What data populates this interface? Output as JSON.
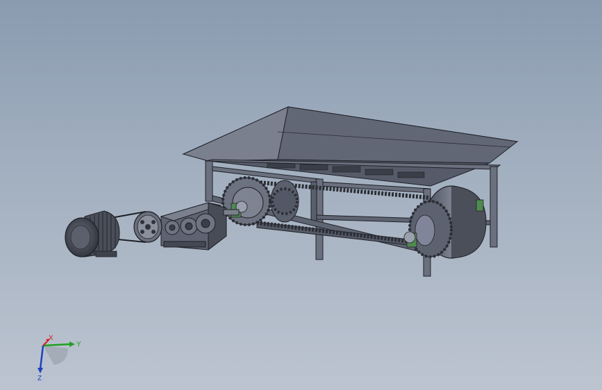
{
  "viewport": {
    "background_top": "#8a9bb0",
    "background_bottom": "#bcc4d0"
  },
  "colors": {
    "steel_light": "#7a7f8c",
    "steel_mid": "#5c6170",
    "steel_dark": "#3c404a",
    "outline": "#1e2026",
    "bearing_green": "#4f8a4f",
    "axis_x": "#d02020",
    "axis_y": "#20a020",
    "axis_z": "#2040c0"
  },
  "model": {
    "parts": [
      "hopper",
      "frame",
      "head-sprocket",
      "tail-drum",
      "chain",
      "gear-reducer",
      "v-belt-pulley",
      "electric-motor",
      "bearing-blocks"
    ]
  },
  "triad": {
    "x_label": "X",
    "y_label": "Y",
    "z_label": "Z"
  }
}
